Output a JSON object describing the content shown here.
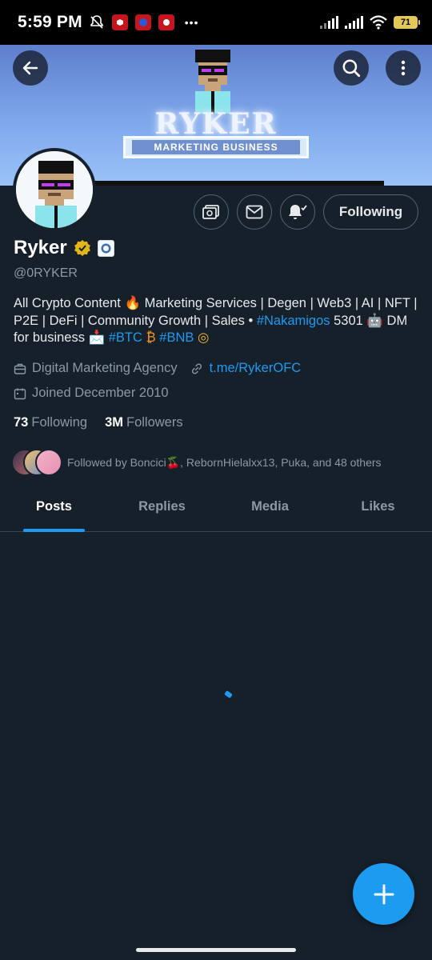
{
  "status_bar": {
    "time": "5:59 PM",
    "battery": "71",
    "more": "•••"
  },
  "banner": {
    "title": "RYKER",
    "subtitle": "MARKETING BUSINESS"
  },
  "profile": {
    "name": "Ryker",
    "handle": "@0RYKER",
    "bio_parts": {
      "p1": "All Crypto Content 🔥 Marketing Services | Degen | Web3 | AI | NFT | P2E | DeFi | Community Growth | Sales • ",
      "hashtag1": "#Nakamigos",
      "p2": " 5301 🤖 DM for business 📩 ",
      "hashtag2": "#BTC",
      "p3": " ₿ ",
      "hashtag3": "#BNB",
      "p4": " ◎"
    },
    "category": "Digital Marketing Agency",
    "website": "t.me/RykerOFC",
    "joined": "Joined December 2010",
    "following_count": "73",
    "following_label": "Following",
    "followers_count": "3M",
    "followers_label": "Followers",
    "followed_by": "Followed by Boncici🍒, RebornHielalxx13, Puka, and 48 others"
  },
  "actions": {
    "following_button": "Following"
  },
  "tabs": [
    {
      "label": "Posts",
      "active": true
    },
    {
      "label": "Replies",
      "active": false
    },
    {
      "label": "Media",
      "active": false
    },
    {
      "label": "Likes",
      "active": false
    }
  ],
  "colors": {
    "accent": "#1d9bf0",
    "background": "#15202b",
    "verified_gold": "#e2b719"
  },
  "icons": [
    "back-arrow-icon",
    "search-icon",
    "more-vertical-icon",
    "subscribe-icon",
    "mail-icon",
    "notification-bell-icon",
    "verified-badge-icon",
    "affiliate-badge-icon",
    "briefcase-icon",
    "link-icon",
    "calendar-icon",
    "compose-plus-icon"
  ]
}
